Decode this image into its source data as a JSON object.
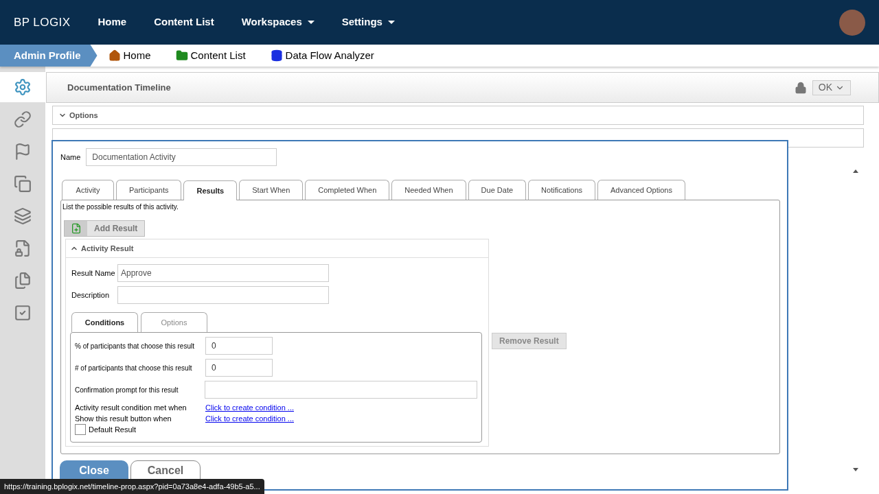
{
  "logo": {
    "text": "BP LOGIX"
  },
  "nav": [
    {
      "label": "Home",
      "dropdown": false
    },
    {
      "label": "Content List",
      "dropdown": false
    },
    {
      "label": "Workspaces",
      "dropdown": true
    },
    {
      "label": "Settings",
      "dropdown": true
    }
  ],
  "breadcrumb": {
    "profile": "Admin Profile",
    "links": [
      {
        "label": "Home",
        "kind": "home"
      },
      {
        "label": "Content List",
        "kind": "folder"
      },
      {
        "label": "Data Flow Analyzer",
        "kind": "database"
      }
    ]
  },
  "sidebar": [
    {
      "kind": "gears",
      "selected": true
    },
    {
      "kind": "link",
      "selected": false
    },
    {
      "kind": "flag",
      "selected": false
    },
    {
      "kind": "squares",
      "selected": false
    },
    {
      "kind": "stacked",
      "selected": false
    },
    {
      "kind": "file-lock",
      "selected": false
    },
    {
      "kind": "files",
      "selected": false
    },
    {
      "kind": "check",
      "selected": false
    }
  ],
  "page": {
    "title": "Documentation Timeline",
    "ok_button": "OK",
    "options": {
      "label": "Options",
      "expanded": false
    }
  },
  "dialog": {
    "name_label": "Name",
    "name_value": "Documentation Activity",
    "tabs": [
      {
        "label": "Activity",
        "selected": false
      },
      {
        "label": "Participants",
        "selected": false
      },
      {
        "label": "Results",
        "selected": true
      },
      {
        "label": "Start When",
        "selected": false
      },
      {
        "label": "Completed When",
        "selected": false
      },
      {
        "label": "Needed When",
        "selected": false
      },
      {
        "label": "Due Date",
        "selected": false
      },
      {
        "label": "Notifications",
        "selected": false
      },
      {
        "label": "Advanced Options",
        "selected": false
      }
    ],
    "instructions": "List the possible results of this activity.",
    "add_result": "Add Result",
    "result": {
      "header": "Activity Result",
      "expanded": true,
      "fields": [
        {
          "label": "Result Name",
          "value": "Approve"
        },
        {
          "label": "Description"
        }
      ],
      "subtabs": [
        {
          "label": "Conditions",
          "selected": true
        },
        {
          "label": "Options",
          "selected": false
        }
      ],
      "rows": [
        {
          "kind": "short-input",
          "label": "% of participants that choose this result",
          "value": "0"
        },
        {
          "kind": "short-input",
          "label": "# of participants that choose this result",
          "value": "0"
        },
        {
          "kind": "long-input",
          "label": "Confirmation prompt for this result"
        },
        {
          "kind": "link",
          "label": "Activity result condition met when",
          "value": "Click to create condition ..."
        },
        {
          "kind": "link",
          "label": "Show this result button when",
          "value": "Click to create condition ..."
        },
        {
          "kind": "checkbox",
          "label": "Default Result",
          "checked": false
        }
      ]
    },
    "remove_result": "Remove Result",
    "close": "Close",
    "cancel": "Cancel"
  },
  "status_url": "https://training.bplogix.net/timeline-prop.aspx?pid=0a73a8e4-adfa-49b5-a5..."
}
